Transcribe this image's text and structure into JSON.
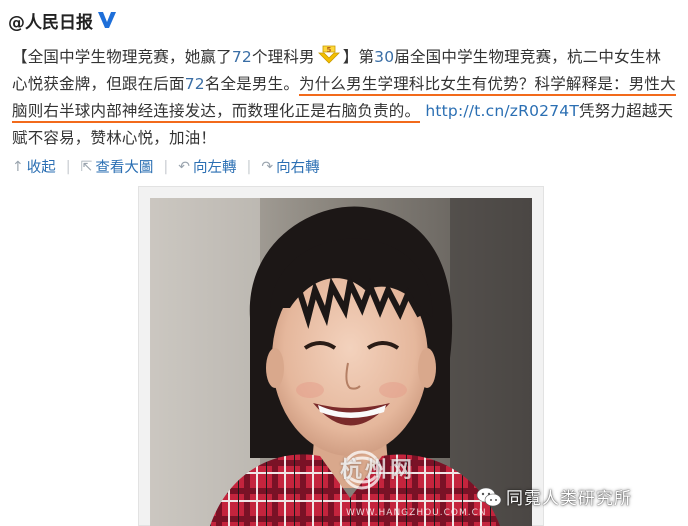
{
  "post": {
    "author": "@人民日报",
    "verified_icon": "verified-v-icon",
    "text": {
      "part1": "【全国中学生物理竞赛，她赢了",
      "num1": "72",
      "part2": "个理科男",
      "emoji": "five-rank-emoji",
      "part3": "】第",
      "num2": "30",
      "part4": "届全国中学生物理竞赛，杭二中女生林心悦获金牌，但跟在后面",
      "num3": "72",
      "part5": "名全是男生。",
      "highlight": "为什么男生学理科比女生有优势？科学解释是：男性大脑则右半球内部神经连接发达，而数理化正是右脑负责的。",
      "link": "http://t.cn/zR0274T",
      "part6": "凭努力超越天赋不容易，赞林心悦，加油！"
    }
  },
  "actions": {
    "collapse": {
      "icon": "arrow-up-icon",
      "label": "收起"
    },
    "view_large": {
      "icon": "external-view-icon",
      "label": "查看大圖"
    },
    "rotate_left": {
      "icon": "rotate-left-icon",
      "label": "向左轉"
    },
    "rotate_right": {
      "icon": "rotate-right-icon",
      "label": "向右轉"
    }
  },
  "photo": {
    "watermark_site": "杭州网",
    "watermark_url": "WWW.HANGZHOU.COM.CN",
    "watermark_source": "同霓人类研究所",
    "watermark_source_icon": "wechat-icon"
  },
  "colors": {
    "link": "#2b6fb3",
    "highlight_underline": "#f26a1b",
    "number": "#3a6ea5"
  }
}
